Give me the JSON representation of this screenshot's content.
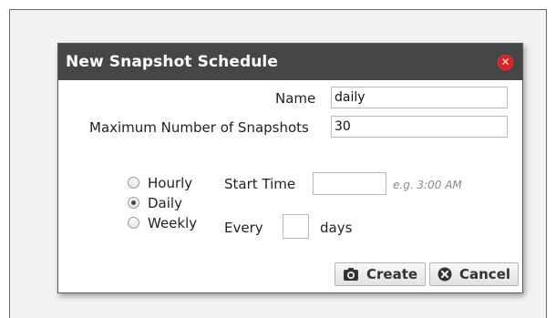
{
  "dialog": {
    "title": "New Snapshot Schedule",
    "close_icon": "close-icon"
  },
  "form": {
    "name_label": "Name",
    "name_value": "daily",
    "max_label": "Maximum Number of Snapshots",
    "max_value": "30",
    "frequency": {
      "options": [
        "Hourly",
        "Daily",
        "Weekly"
      ],
      "selected": "Daily"
    },
    "start_time_label": "Start Time",
    "start_time_value": "",
    "start_time_hint": "e.g. 3:00 AM",
    "every_label": "Every",
    "every_value": "",
    "days_label": "days"
  },
  "buttons": {
    "create_label": "Create",
    "create_icon": "camera-icon",
    "cancel_label": "Cancel",
    "cancel_icon": "cancel-circle-icon"
  },
  "colors": {
    "titlebar": "#444648",
    "close": "#e02020"
  }
}
